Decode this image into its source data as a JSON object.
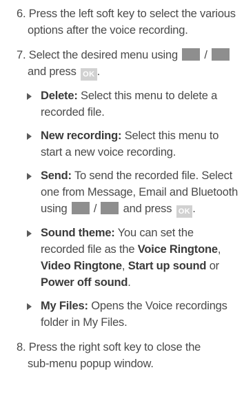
{
  "step6": {
    "number": "6.",
    "line1": "Press the left soft key to select the various",
    "line2": "options after the voice recording."
  },
  "step7": {
    "number": "7.",
    "text_a": "Select the desired menu using",
    "slash": "/",
    "text_b": "and press",
    "ok_label": "OK",
    "period": "."
  },
  "bullets": [
    {
      "label": "Delete:",
      "text": "Select this menu to delete a recorded file."
    },
    {
      "label": "New recording:",
      "text": "Select this menu to start a new voice recording."
    },
    {
      "label": "Send:",
      "text_a": "To send the recorded file. Select one from Message, Email and Bluetooth using",
      "slash": "/",
      "text_b": "and press",
      "ok_label": "OK",
      "period": "."
    },
    {
      "label": "Sound theme:",
      "text_a": "You can set the recorded file as the",
      "opt1": "Voice Ringtone",
      "comma1": ",",
      "opt2": "Video Ringtone",
      "comma2": ",",
      "opt3": "Start up sound",
      "or": "or",
      "opt4": "Power off sound",
      "period": "."
    },
    {
      "label": "My Files:",
      "text": "Opens the Voice recordings folder in My Files."
    }
  ],
  "step8": {
    "number": "8.",
    "line1": "Press the right soft key to close the",
    "line2": "sub-menu popup window."
  }
}
